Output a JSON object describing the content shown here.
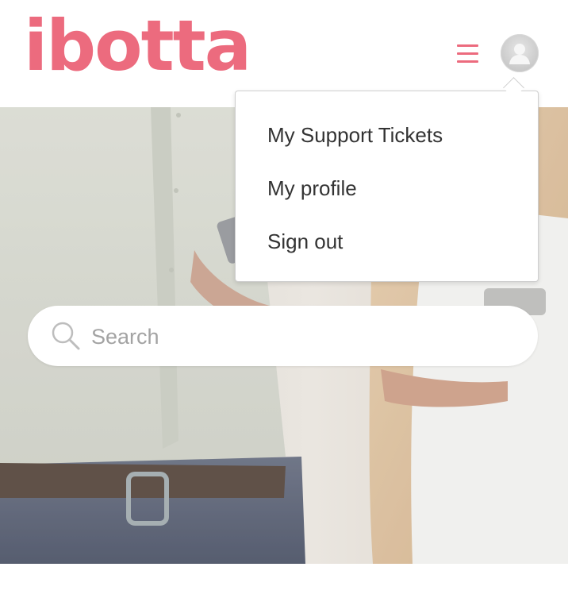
{
  "header": {
    "logo_text": "ibotta",
    "logo_mark": "®",
    "menu_icon": "hamburger-menu-icon",
    "avatar_icon": "user-avatar-icon"
  },
  "colors": {
    "brand": "#ec6b7e",
    "dropdown_text": "#333333",
    "search_placeholder": "#a3a3a3"
  },
  "search": {
    "icon": "search-icon",
    "placeholder": "Search",
    "value": ""
  },
  "dropdown": {
    "items": [
      {
        "label": "My Support Tickets"
      },
      {
        "label": "My profile"
      },
      {
        "label": "Sign out"
      }
    ]
  },
  "hero": {
    "image": "two-people-holding-phones-photo"
  }
}
